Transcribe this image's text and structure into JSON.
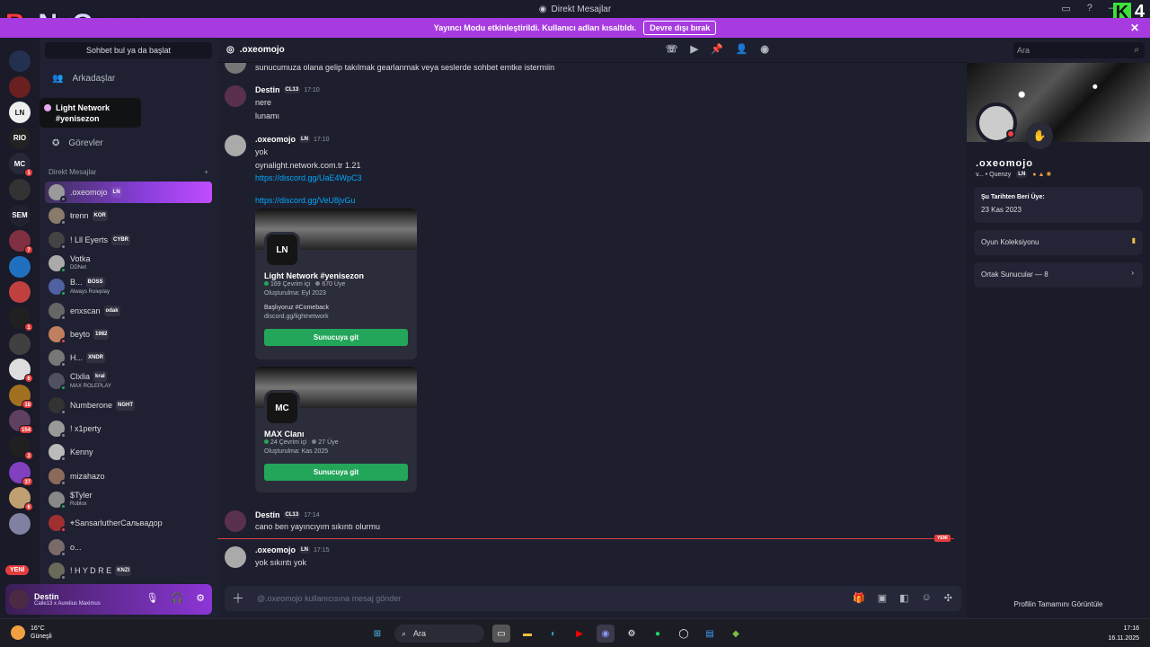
{
  "window": {
    "title": "Direkt Mesajlar"
  },
  "brand": {
    "text1": "By",
    "text2": "NoGame",
    "corner_k": "K",
    "corner_num": "4"
  },
  "banner": {
    "text": "Yayıncı Modu etkinleştirildi. Kullanıcı adları kısaltıldı.",
    "button": "Devre dışı bırak"
  },
  "rail": {
    "servers": [
      {
        "label": "",
        "badge": "",
        "color": "#243050"
      },
      {
        "label": "",
        "badge": "",
        "color": "#6a2020"
      },
      {
        "label": "LN",
        "badge": "",
        "color": "#eeeeee"
      },
      {
        "label": "RIO",
        "badge": "",
        "color": "#222222"
      },
      {
        "label": "MC",
        "badge": "1",
        "color": "#26283a"
      },
      {
        "label": "",
        "badge": "",
        "color": "#333333"
      },
      {
        "label": "SEM",
        "badge": "",
        "color": "#202230"
      },
      {
        "label": "",
        "badge": "7",
        "color": "#803040"
      },
      {
        "label": "",
        "badge": "",
        "color": "#2070c0"
      },
      {
        "label": "",
        "badge": "",
        "color": "#c04040"
      },
      {
        "label": "",
        "badge": "1",
        "color": "#202020"
      },
      {
        "label": "",
        "badge": "",
        "color": "#404040"
      },
      {
        "label": "",
        "badge": "6",
        "color": "#dddddd"
      },
      {
        "label": "",
        "badge": "18",
        "color": "#a07020"
      },
      {
        "label": "",
        "badge": "154",
        "color": "#604060"
      },
      {
        "label": "",
        "badge": "3",
        "color": "#202020"
      },
      {
        "label": "",
        "badge": "37",
        "color": "#8040c0"
      },
      {
        "label": "",
        "badge": "6",
        "color": "#c0a070"
      },
      {
        "label": "",
        "badge": "",
        "color": "#8080a0"
      }
    ],
    "new_pill": "YENİ"
  },
  "sidebar": {
    "search": "Sohbet bul ya da başlat",
    "friends": "Arkadaşlar",
    "quests": "Görevler",
    "tooltip_line1": "Light Network",
    "tooltip_line2": "#yenisezon",
    "dm_header": "Direkt Mesajlar",
    "dm_add": "+",
    "dms": [
      {
        "name": ".oxeomojo",
        "tag": "LN",
        "sub": "",
        "status": "#80848e",
        "active": true
      },
      {
        "name": "ŧrenn",
        "tag": "KOR",
        "sub": "",
        "status": "#80848e",
        "active": false
      },
      {
        "name": "! Lll Eyerts",
        "tag": "CYBR",
        "sub": "",
        "status": "#80848e",
        "active": false
      },
      {
        "name": "Votka",
        "tag": "",
        "sub": "DDNet",
        "status": "#23a55a",
        "active": false
      },
      {
        "name": "B...",
        "tag": "BOSS",
        "sub": "Always Roleplay",
        "status": "#23a55a",
        "active": false
      },
      {
        "name": "enxscan",
        "tag": "odak",
        "sub": "",
        "status": "#80848e",
        "active": false
      },
      {
        "name": "beyto",
        "tag": "1982",
        "sub": "",
        "status": "#f23f43",
        "active": false
      },
      {
        "name": "H...",
        "tag": "XNDR",
        "sub": "",
        "status": "#80848e",
        "active": false
      },
      {
        "name": "Clxlia",
        "tag": "kral",
        "sub": "MAX ROLEPLAY",
        "status": "#23a55a",
        "active": false
      },
      {
        "name": "Numberone",
        "tag": "NGHT",
        "sub": "",
        "status": "#80848e",
        "active": false
      },
      {
        "name": "! x1perty",
        "tag": "",
        "sub": "",
        "status": "#80848e",
        "active": false
      },
      {
        "name": "Kenny",
        "tag": "",
        "sub": "",
        "status": "#80848e",
        "active": false
      },
      {
        "name": "mizahazo",
        "tag": "",
        "sub": "",
        "status": "#80848e",
        "active": false
      },
      {
        "name": "$Tyler",
        "tag": "",
        "sub": "Roblox",
        "status": "#23a55a",
        "active": false
      },
      {
        "name": "⌖SansarluthеrСальвадор",
        "tag": "",
        "sub": "",
        "status": "#f23f43",
        "active": false
      },
      {
        "name": "o...",
        "tag": "",
        "sub": "",
        "status": "#80848e",
        "active": false
      },
      {
        "name": "! H Y D R E",
        "tag": "KNZI",
        "sub": "",
        "status": "#80848e",
        "active": false
      }
    ]
  },
  "user": {
    "name": "Destin",
    "sub": "Callе13 x Aurelius Maximus"
  },
  "chat": {
    "title": ".oxeomojo",
    "search": "Ara",
    "top_line": "sunucumuza olana gelip takılmak gearlanmak veya seslerde sohbet emtke istermiin",
    "messages": [
      {
        "author": "Destin",
        "tag": "CL13",
        "time": "17:10",
        "lines": [
          "nere",
          "lunamı"
        ]
      },
      {
        "author": ".oxeomojo",
        "tag": "LN",
        "time": "17:10",
        "lines": [
          "yok",
          "oynalight.network.com.tr 1.21"
        ],
        "links": [
          "https://discord.gg/UaE4WpC3",
          "https://discord.gg/VeU8jvGu"
        ]
      },
      {
        "author": "Destin",
        "tag": "CL13",
        "time": "17:14",
        "lines": [
          "cano ben yayıncıyım sıkıntı olurmu"
        ]
      },
      {
        "author": ".oxeomojo",
        "tag": "LN",
        "time": "17:15",
        "lines": [
          "yok sıkıntı yok"
        ]
      }
    ],
    "invite1": {
      "icon": "LN",
      "title": "Light Network #yenisezon",
      "online": "169 Çevrim içi",
      "members": "670 Üye",
      "created": "Oluşturulma: Eyl 2023",
      "desc": "Başlıyoruz #Comeback",
      "link": "discord.gg/lightnetwork",
      "button": "Sunucuya git"
    },
    "invite2": {
      "icon": "MC",
      "title": "MAX Clanı",
      "online": "24 Çevrim içi",
      "members": "27 Üye",
      "created": "Oluşturulma: Kas 2025",
      "button": "Sunucuya git"
    },
    "new_tag": "YENİ",
    "composer_placeholder": "@.oxeomojo kullanıcısına mesaj gönder"
  },
  "profile": {
    "name": ".oxeomojo",
    "sub": "v... • Quenzy",
    "tag": "LN",
    "member_since_label": "Şu Tarihten Beri Üye:",
    "member_since": "23 Kas 2023",
    "games": "Oyun Koleksiyonu",
    "mutual": "Ortak Sunucular — 8",
    "footer": "Profilin Tamamını Görüntüle"
  },
  "taskbar": {
    "temp": "16°C",
    "weather": "Güneşli",
    "search": "Ara",
    "time": "17:16",
    "date": "16.11.2025"
  }
}
